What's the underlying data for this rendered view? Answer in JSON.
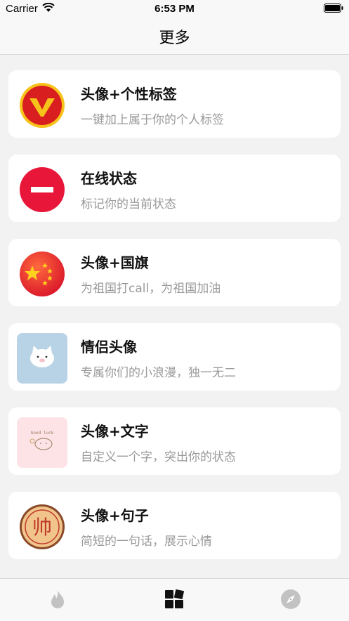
{
  "status_bar": {
    "carrier": "Carrier",
    "time": "6:53 PM"
  },
  "nav": {
    "title": "更多"
  },
  "items": [
    {
      "title": "头像+个性标签",
      "subtitle": "一键加上属于你的个人标签",
      "icon": "v-badge-icon"
    },
    {
      "title": "在线状态",
      "subtitle": "标记你的当前状态",
      "icon": "no-entry-icon"
    },
    {
      "title": "头像+国旗",
      "subtitle": "为祖国打call，为祖国加油",
      "icon": "flag-icon"
    },
    {
      "title": "情侣头像",
      "subtitle": "专属你们的小浪漫，独一无二",
      "icon": "couple-avatar-icon"
    },
    {
      "title": "头像+文字",
      "subtitle": "自定义一个字，突出你的状态",
      "icon": "text-avatar-icon"
    },
    {
      "title": "头像+句子",
      "subtitle": "简短的一句话，展示心情",
      "icon": "sentence-avatar-icon"
    }
  ],
  "icon_texts": {
    "shuai": "帅",
    "good_luck": "Good luck"
  },
  "tabs": [
    {
      "name": "hot",
      "icon": "flame-icon"
    },
    {
      "name": "more",
      "icon": "grid-icon"
    },
    {
      "name": "discover",
      "icon": "compass-icon"
    }
  ],
  "colors": {
    "background": "#f2f2f2",
    "card": "#ffffff",
    "title": "#111111",
    "subtitle": "#999999",
    "accent_red": "#e8173a"
  }
}
